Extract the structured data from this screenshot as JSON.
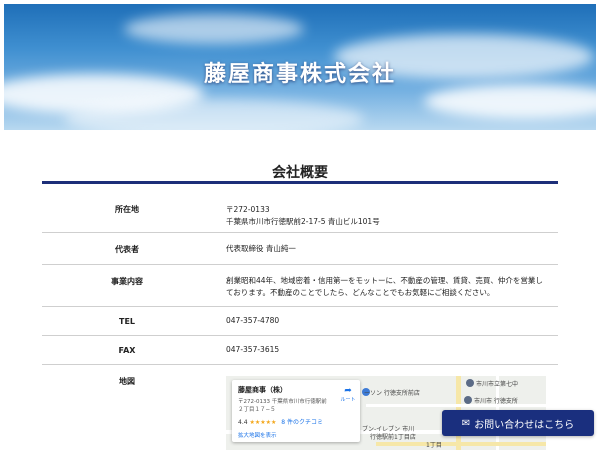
{
  "hero": {
    "title": "藤屋商事株式会社"
  },
  "section": {
    "title": "会社概要"
  },
  "rows": [
    {
      "label": "所在地",
      "value_lines": [
        "〒272-0133",
        "千葉県市川市行徳駅前2-17-5 青山ビル101号"
      ]
    },
    {
      "label": "代表者",
      "value_lines": [
        "代表取締役 青山純一"
      ]
    },
    {
      "label": "事業内容",
      "value_lines": [
        "創業昭和44年、地域密着・信用第一をモットーに、不動産の管理、賃貸、売買、仲介を営業し",
        "ております。不動産のことでしたら、どんなことでもお気軽にご相談ください。"
      ]
    },
    {
      "label": "TEL",
      "value_lines": [
        "047-357-4780"
      ]
    },
    {
      "label": "FAX",
      "value_lines": [
        "047-357-3615"
      ]
    },
    {
      "label": "地図",
      "value_lines": []
    }
  ],
  "map": {
    "place_name": "藤屋商事（株）",
    "address": "〒272-0133 千葉県市川市行徳駅前２丁目１７−５",
    "rating": "4.4",
    "stars": "★★★★★",
    "reviews": "8 件のクチコミ",
    "enlarge": "拡大地図を表示",
    "directions": "ルート",
    "labels": {
      "lawson": "ーソン 行徳支所前店",
      "ichikawa": "市川市立第七中",
      "gyotoku_office": "市川市 行徳支所",
      "seven": "ブン-イレブン 市川",
      "seven2": "行徳駅前1丁目店",
      "chome": "1丁目"
    }
  },
  "contact_button": {
    "icon": "mail-icon",
    "label": "お問い合わせはこちら"
  }
}
